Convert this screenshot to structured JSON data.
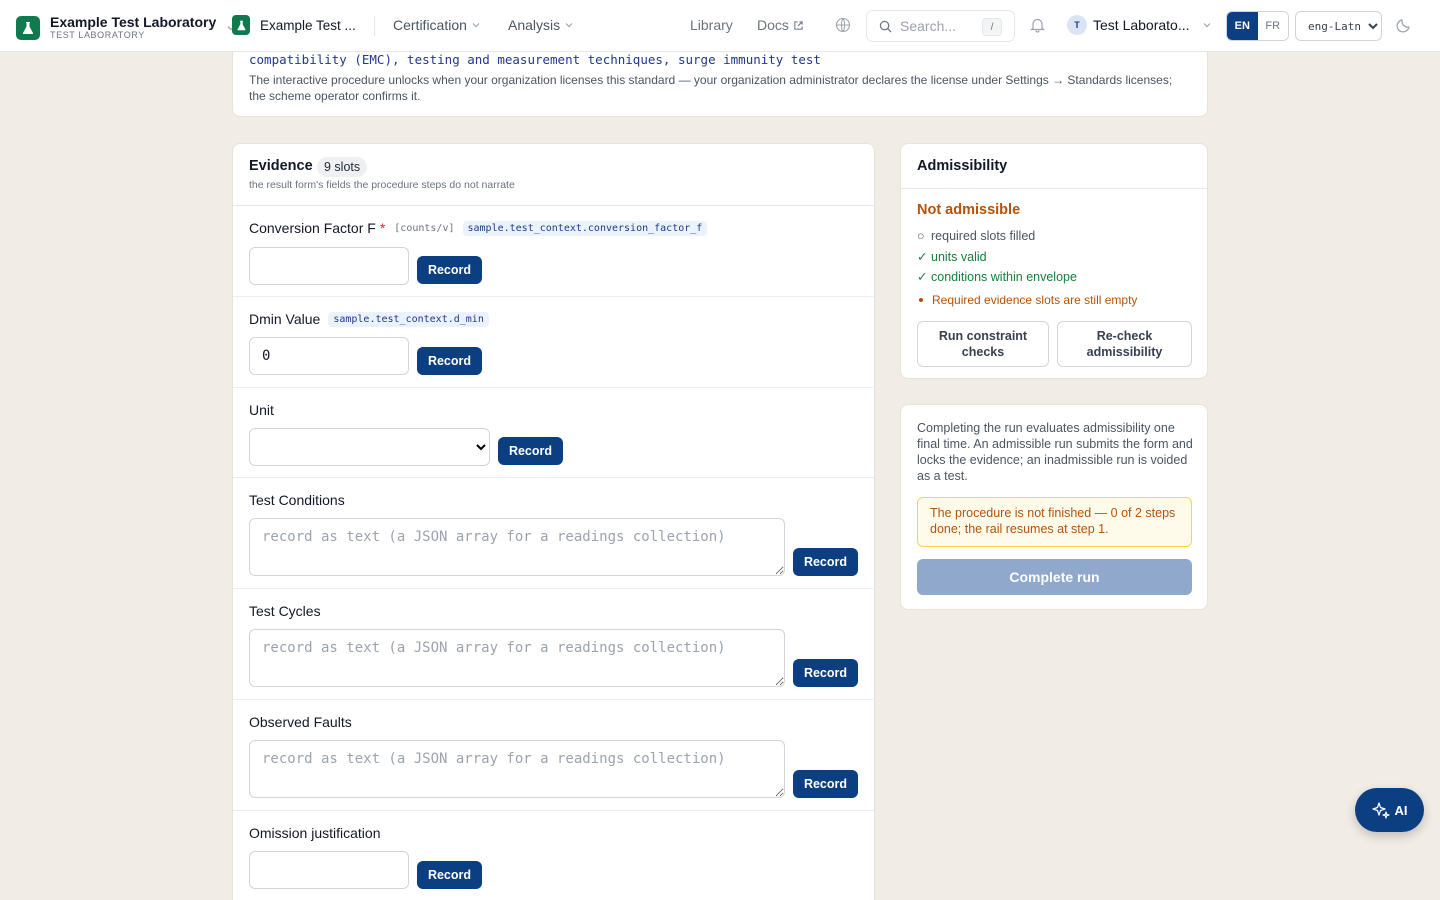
{
  "topbar": {
    "org_name": "Example Test Laboratory",
    "org_sub": "TEST LABORATORY",
    "workspace": "Example Test ...",
    "nav": [
      "Certification",
      "Analysis"
    ],
    "library": "Library",
    "docs": "Docs",
    "search_placeholder": "Search...",
    "search_shortcut": "/",
    "user_initial": "T",
    "user_name": "Test Laborato...",
    "lang_active": "EN",
    "lang_other": "FR",
    "script": "eng-Latn"
  },
  "standard": {
    "title": "compatibility (EMC), testing and measurement techniques, surge immunity test",
    "note": "The interactive procedure unlocks when your organization licenses this standard — your organization administrator declares the license under Settings → Standards licenses; the scheme operator confirms it."
  },
  "evidence": {
    "title": "Evidence",
    "badge": "9 slots",
    "subtitle": "the result form's fields the procedure steps do not narrate",
    "record_label": "Record",
    "slots": [
      {
        "label": "Conversion Factor F",
        "required": "*",
        "unit": "[counts/v]",
        "path": "sample.test_context.conversion_factor_f",
        "value": ""
      },
      {
        "label": "Dmin Value",
        "path": "sample.test_context.d_min",
        "value": "0"
      },
      {
        "label": "Unit"
      },
      {
        "label": "Test Conditions",
        "placeholder": "record as text (a JSON array for a readings collection)"
      },
      {
        "label": "Test Cycles",
        "placeholder": "record as text (a JSON array for a readings collection)"
      },
      {
        "label": "Observed Faults",
        "placeholder": "record as text (a JSON array for a readings collection)"
      },
      {
        "label": "Omission justification",
        "value": ""
      }
    ]
  },
  "admissibility": {
    "title": "Admissibility",
    "status": "Not admissible",
    "checks": [
      {
        "icon": "○",
        "text": "required slots filled"
      },
      {
        "icon": "✓",
        "text": "units valid"
      },
      {
        "icon": "✓",
        "text": "conditions within envelope"
      }
    ],
    "warning": "Required evidence slots are still empty",
    "btn_constraints": "Run constraint checks",
    "btn_recheck": "Re-check admissibility"
  },
  "completion": {
    "text": "Completing the run evaluates admissibility one final time. An admissible run submits the form and locks the evidence; an inadmissible run is voided as a test.",
    "warning": "The procedure is not finished — 0 of 2 steps done; the rail resumes at step 1.",
    "button": "Complete run"
  },
  "ai": {
    "label": "AI"
  },
  "colors": {
    "brand": "#0b3f82",
    "logo": "#0f7a4d",
    "warn": "#b45309",
    "ok": "#15803d"
  }
}
